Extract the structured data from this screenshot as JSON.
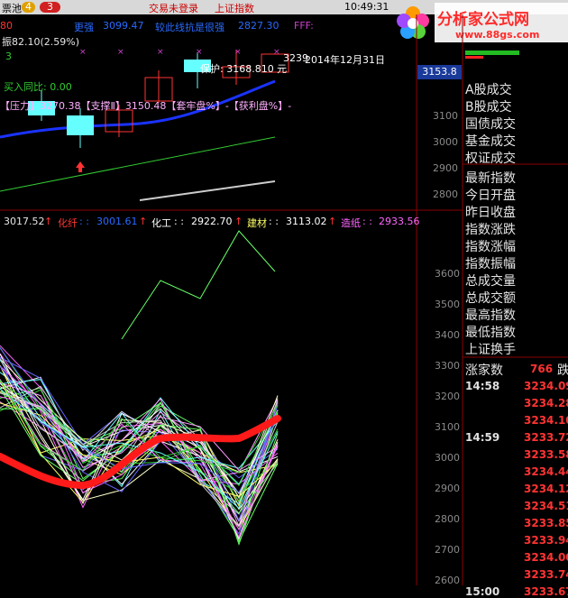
{
  "topbar": {
    "left_label": "票池",
    "badge_a": "4",
    "badge_b": "3",
    "login_status": "交易未登录",
    "index_name": "上证指数",
    "clock": "10:49:31"
  },
  "logo": {
    "title": "分析家公式网",
    "url": "www.88gs.com"
  },
  "kchart": {
    "row1": {
      "label_a": "更强",
      "value_a": "3099.47",
      "label_b": "较此线抗是很强",
      "value_b": "2827.30",
      "label_c": "FFF:"
    },
    "amplitude": "振82.10(2.59%)",
    "buy_inout": "买入同比: 0.00",
    "indicator_line": "【压力】3270.38【支撑Ⅱ】3150.48【套牢盘%】-【获利盘%】-",
    "date_label": "2014年12月31日",
    "support_label": "保护: 3168.810 元",
    "price_3239": "3239",
    "last_price": "3153.8",
    "y_labels": [
      "3100",
      "3000",
      "2900",
      "2800"
    ],
    "left_marker": "3"
  },
  "sector_header": {
    "base_value": "3017.52",
    "items": [
      {
        "name": "化纤",
        "value": "3001.61"
      },
      {
        "name": "化工",
        "value": "2922.70"
      },
      {
        "name": "建材",
        "value": "3113.02"
      },
      {
        "name": "造纸",
        "value": "2933.56"
      }
    ]
  },
  "sector_chart": {
    "y_labels": [
      "3600",
      "3500",
      "3400",
      "3300",
      "3200",
      "3100",
      "3000",
      "2900",
      "2800",
      "2700",
      "2600"
    ]
  },
  "side_panel": {
    "items": [
      "A股成交",
      "B股成交",
      "国债成交",
      "基金成交",
      "权证成交",
      "最新指数",
      "今日开盘",
      "昨日收盘",
      "指数涨跌",
      "指数涨幅",
      "指数振幅",
      "总成交量",
      "总成交额",
      "最高指数",
      "最低指数",
      "上证换手"
    ],
    "rise_label": "涨家数",
    "rise_count": "766",
    "fall_label": "跌",
    "ticks": [
      {
        "time": "14:58",
        "value": "3234.09"
      },
      {
        "time": "",
        "value": "3234.28"
      },
      {
        "time": "",
        "value": "3234.10"
      },
      {
        "time": "14:59",
        "value": "3233.72"
      },
      {
        "time": "",
        "value": "3233.58"
      },
      {
        "time": "",
        "value": "3234.44"
      },
      {
        "time": "",
        "value": "3234.12"
      },
      {
        "time": "",
        "value": "3234.51"
      },
      {
        "time": "",
        "value": "3233.85"
      },
      {
        "time": "",
        "value": "3233.94"
      },
      {
        "time": "",
        "value": "3234.00"
      },
      {
        "time": "",
        "value": "3233.74"
      },
      {
        "time": "15:00",
        "value": "3233.67"
      }
    ]
  },
  "colors": {
    "up": "#ff3333",
    "down_candle": "#66ffff",
    "ma_blue": "#1a33ff",
    "ma_green": "#33cc33",
    "ma_white": "#cccccc",
    "thick_line": "#ff1a1a",
    "header_text": "#ff3333"
  }
}
